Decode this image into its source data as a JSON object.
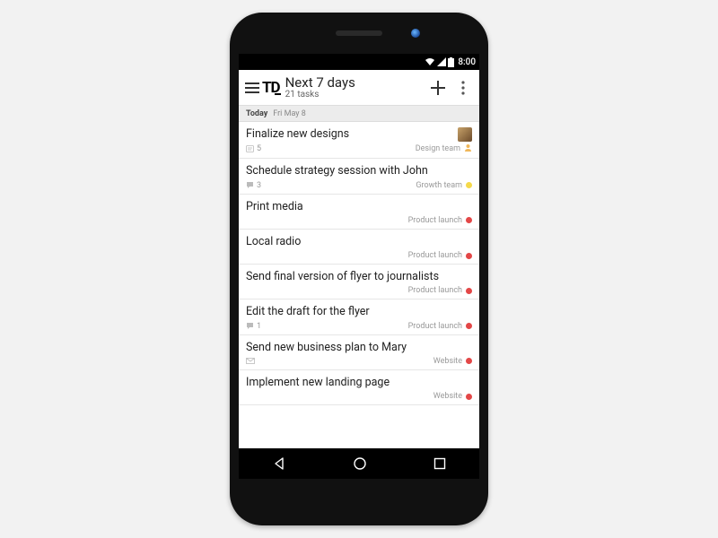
{
  "statusbar": {
    "time": "8:00"
  },
  "appbar": {
    "title": "Next 7 days",
    "subtitle": "21 tasks"
  },
  "section": {
    "today_label": "Today",
    "date_label": "Fri May 8"
  },
  "projects": {
    "design": {
      "name": "Design team",
      "color": "#f0b75a"
    },
    "growth": {
      "name": "Growth team",
      "color": "#f5d94a"
    },
    "launch": {
      "name": "Product launch",
      "color": "#e34747"
    },
    "website": {
      "name": "Website",
      "color": "#e34747"
    }
  },
  "tasks": [
    {
      "title": "Finalize new designs",
      "comments": "5",
      "comment_icon": "note",
      "project": "design",
      "avatar": true,
      "assignee_icon": true
    },
    {
      "title": "Schedule strategy session with John",
      "comments": "3",
      "comment_icon": "chat",
      "project": "growth"
    },
    {
      "title": "Print media",
      "project": "launch"
    },
    {
      "title": "Local radio",
      "project": "launch"
    },
    {
      "title": "Send final version of flyer to journalists",
      "project": "launch"
    },
    {
      "title": "Edit the draft for the flyer",
      "comments": "1",
      "comment_icon": "chat",
      "project": "launch"
    },
    {
      "title": "Send new business plan to Mary",
      "comment_icon": "mail",
      "project": "website"
    },
    {
      "title": "Implement new landing page",
      "project": "website"
    }
  ]
}
